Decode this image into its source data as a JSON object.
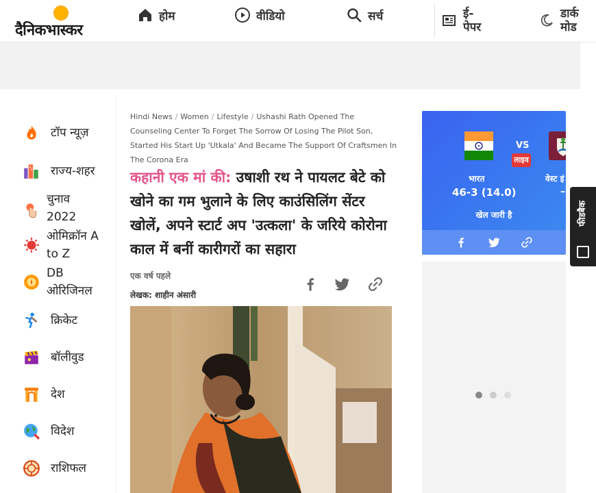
{
  "header": {
    "logo_text": "दैनिकभास्कर",
    "nav": [
      {
        "label": "होम",
        "icon": "home-icon"
      },
      {
        "label": "वीडियो",
        "icon": "play-icon"
      },
      {
        "label": "सर्च",
        "icon": "search-icon"
      },
      {
        "label_line1": "ई-",
        "label_line2": "पेपर",
        "icon": "newspaper-icon"
      },
      {
        "label_line1": "डार्क",
        "label_line2": "मोड",
        "icon": "moon-icon"
      }
    ]
  },
  "sidebar": {
    "items": [
      {
        "label": "टॉप न्यूज़",
        "icon": "fire-icon",
        "color": "#ff6d00"
      },
      {
        "label": "राज्य-शहर",
        "icon": "city-icon",
        "color": "#7e57c2"
      },
      {
        "label": "चुनाव 2022",
        "line1": "चुनाव",
        "line2": "2022",
        "icon": "vote-icon",
        "color": "#ff7043"
      },
      {
        "label": "ओमिक्रॉन A to Z",
        "line1": "ओमिक्रॉन A",
        "line2": "to Z",
        "icon": "virus-icon",
        "color": "#e53935"
      },
      {
        "label": "DB ओरिजिनल",
        "line1": "DB",
        "line2": "ओरिजिनल",
        "icon": "db-original-icon",
        "color": "#ff9800"
      },
      {
        "label": "क्रिकेट",
        "icon": "cricket-icon",
        "color": "#1e88e5"
      },
      {
        "label": "बॉलीवुड",
        "icon": "clapperboard-icon",
        "color": "#8e24aa"
      },
      {
        "label": "देश",
        "icon": "india-gate-icon",
        "color": "#f57c00"
      },
      {
        "label": "विदेश",
        "icon": "globe-icon",
        "color": "#43a047"
      },
      {
        "label": "राशिफल",
        "icon": "zodiac-icon",
        "color": "#d84315"
      }
    ]
  },
  "article": {
    "breadcrumb": [
      "Hindi News",
      "Women",
      "Lifestyle",
      "Ushashi Rath Opened The Counseling Center To Forget The Sorrow Of Losing The Pilot Son, Started His Start Up 'Utkala' And Became The Support Of Craftsmen In The Corona Era"
    ],
    "kicker": "कहानी एक मां की:",
    "headline": " उषाशी रथ ने पायलट बेटे को खोने का गम भुलाने के लिए काउंसिलिंग सेंटर खोलें, अपने स्टार्ट अप 'उत्कला' के जरिये कोरोना काल में बनीं कारीगरों का सहारा",
    "time": "एक वर्ष पहले",
    "author": "लेखक: शाहीन अंसारी",
    "kicker_color": "#e4538a"
  },
  "score_card": {
    "vs": "VS",
    "live": "लाइव",
    "team1": "भारत",
    "score1": "46-3 (14.0)",
    "team2": "वेस्ट इं",
    "score2": "–",
    "status": "खेल जारी है",
    "color": "#3a63f0"
  },
  "feedback": {
    "label": "फीडबैक"
  }
}
